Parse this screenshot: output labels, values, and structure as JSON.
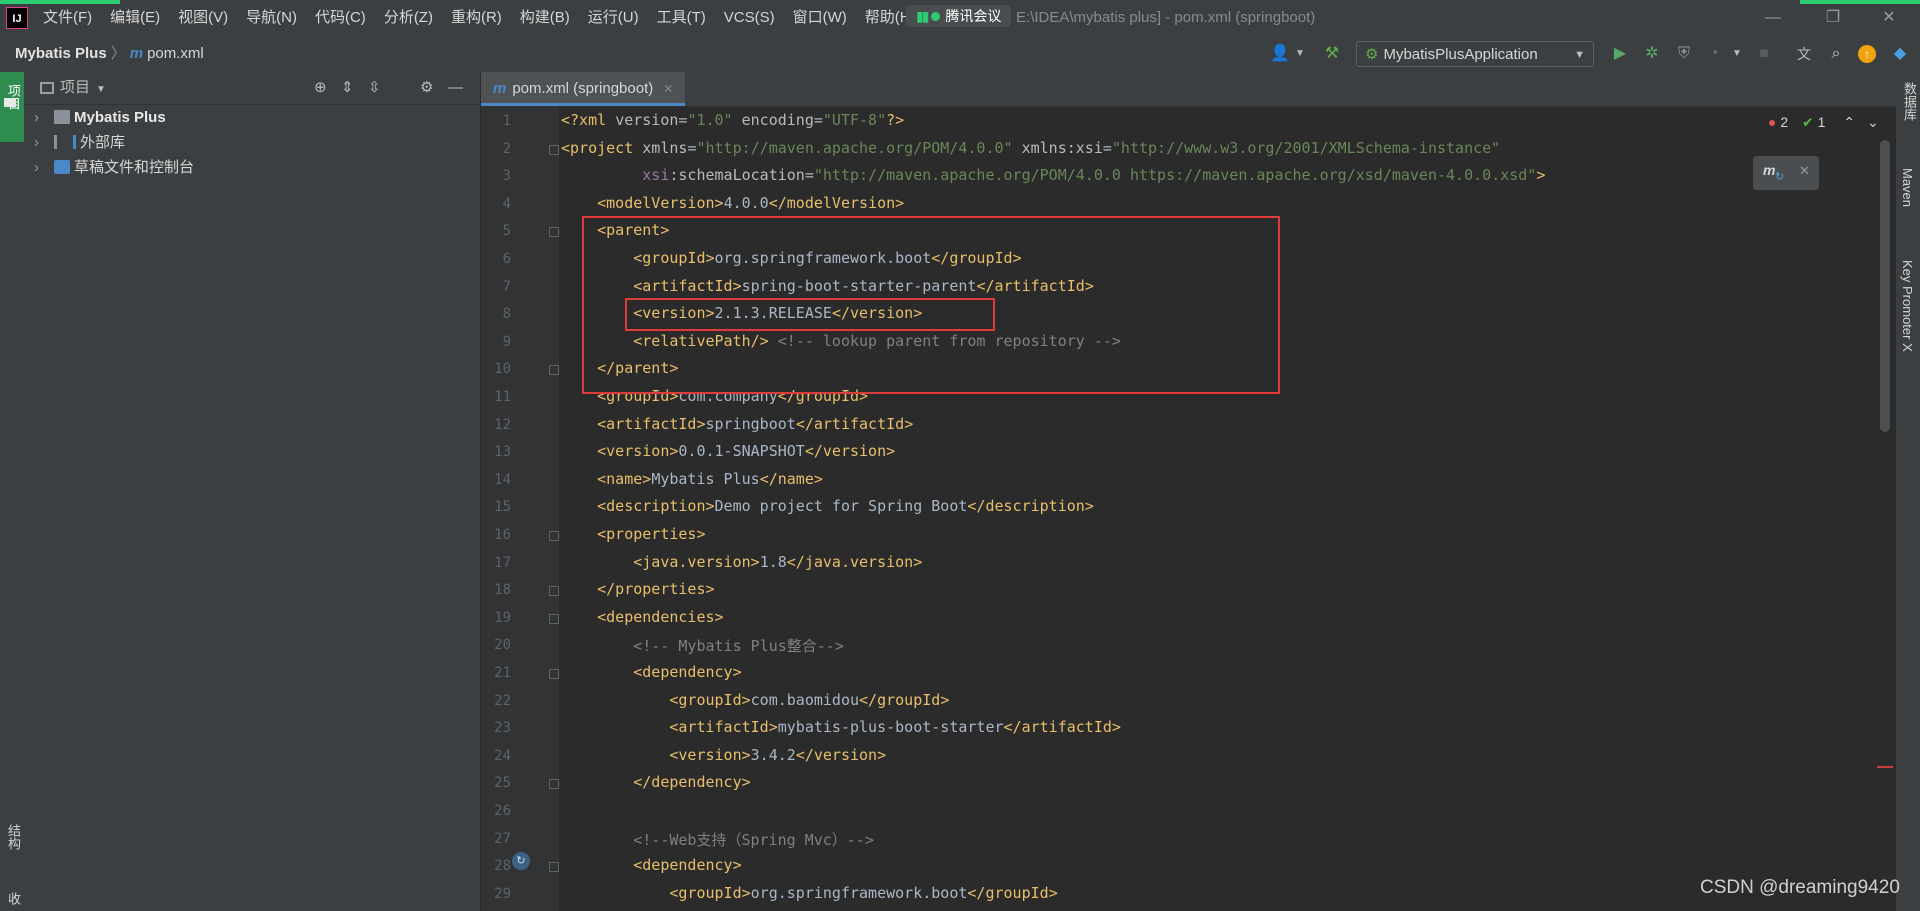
{
  "window": {
    "title": "E:\\IDEA\\mybatis plus] - pom.xml (springboot)",
    "logo": "IJ",
    "meeting_label": "腾讯会议",
    "menus": [
      "文件(F)",
      "编辑(E)",
      "视图(V)",
      "导航(N)",
      "代码(C)",
      "分析(Z)",
      "重构(R)",
      "构建(B)",
      "运行(U)",
      "工具(T)",
      "VCS(S)",
      "窗口(W)",
      "帮助(H)"
    ],
    "controls": {
      "minimize": "—",
      "restore": "❐",
      "close": "✕"
    }
  },
  "breadcrumb": {
    "project": "Mybatis Plus",
    "file": "pom.xml"
  },
  "toolbar": {
    "run_config": "MybatisPlusApplication"
  },
  "left_strip": {
    "project_tab": "项目",
    "structure_tab": "结构",
    "bottom_tab": "收"
  },
  "project_panel": {
    "title": "项目",
    "tree": [
      {
        "label": "Mybatis Plus",
        "bold": true,
        "icon": "folder-icon"
      },
      {
        "label": "外部库",
        "bold": false,
        "icon": "library-icon"
      },
      {
        "label": "草稿文件和控制台",
        "bold": false,
        "icon": "scratch-icon"
      }
    ]
  },
  "editor": {
    "tab_label": "pom.xml (springboot)",
    "inspections": {
      "errors": "2",
      "warnings": "1"
    },
    "maven_popup": "m",
    "line_numbers": [
      "1",
      "2",
      "3",
      "4",
      "5",
      "6",
      "7",
      "8",
      "9",
      "10",
      "11",
      "12",
      "13",
      "14",
      "15",
      "16",
      "17",
      "18",
      "19",
      "20",
      "21",
      "22",
      "23",
      "24",
      "25",
      "26",
      "27",
      "28",
      "29"
    ],
    "lines": [
      "<?xml version=\"1.0\" encoding=\"UTF-8\"?>",
      "<project xmlns=\"http://maven.apache.org/POM/4.0.0\" xmlns:xsi=\"http://www.w3.org/2001/XMLSchema-instance\"",
      "         xsi:schemaLocation=\"http://maven.apache.org/POM/4.0.0 https://maven.apache.org/xsd/maven-4.0.0.xsd\">",
      "    <modelVersion>4.0.0</modelVersion>",
      "    <parent>",
      "        <groupId>org.springframework.boot</groupId>",
      "        <artifactId>spring-boot-starter-parent</artifactId>",
      "        <version>2.1.3.RELEASE</version>",
      "        <relativePath/> <!-- lookup parent from repository -->",
      "    </parent>",
      "    <groupId>com.company</groupId>",
      "    <artifactId>springboot</artifactId>",
      "    <version>0.0.1-SNAPSHOT</version>",
      "    <name>Mybatis Plus</name>",
      "    <description>Demo project for Spring Boot</description>",
      "    <properties>",
      "        <java.version>1.8</java.version>",
      "    </properties>",
      "    <dependencies>",
      "        <!-- Mybatis Plus整合-->",
      "        <dependency>",
      "            <groupId>com.baomidou</groupId>",
      "            <artifactId>mybatis-plus-boot-starter</artifactId>",
      "            <version>3.4.2</version>",
      "        </dependency>",
      "",
      "        <!--Web支持（Spring Mvc）-->",
      "        <dependency>",
      "            <groupId>org.springframework.boot</groupId>"
    ]
  },
  "right_strip": {
    "database": "数据库",
    "maven": "Maven",
    "key_promoter": "Key Promoter X"
  },
  "watermark": "CSDN @dreaming9420",
  "colors": {
    "tag": "#e8bf6a",
    "attr_value": "#6a8759",
    "comment": "#808080",
    "highlight_box": "#e03b3b"
  }
}
